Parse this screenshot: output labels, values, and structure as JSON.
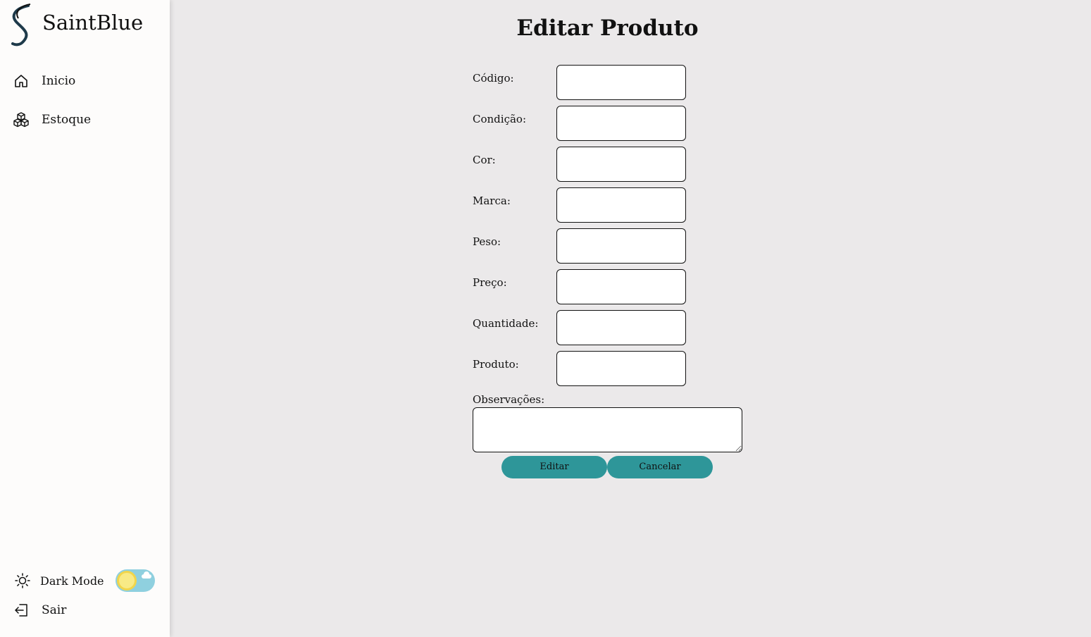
{
  "app": {
    "brand": "SaintBlue"
  },
  "sidebar": {
    "items": [
      {
        "label": "Inicio",
        "icon": "home-icon"
      },
      {
        "label": "Estoque",
        "icon": "boxes-icon"
      }
    ],
    "dark_mode_label": "Dark Mode",
    "dark_mode_enabled": false,
    "logout_label": "Sair"
  },
  "form": {
    "title": "Editar Produto",
    "fields": [
      {
        "label": "Código:",
        "value": ""
      },
      {
        "label": "Condição:",
        "value": ""
      },
      {
        "label": "Cor:",
        "value": ""
      },
      {
        "label": "Marca:",
        "value": ""
      },
      {
        "label": "Peso:",
        "value": ""
      },
      {
        "label": "Preço:",
        "value": ""
      },
      {
        "label": "Quantidade:",
        "value": ""
      },
      {
        "label": "Produto:",
        "value": ""
      }
    ],
    "observations_label": "Observações:",
    "observations_value": "",
    "submit_label": "Editar",
    "cancel_label": "Cancelar"
  },
  "colors": {
    "accent": "#2e9699",
    "background": "#ebe9ea",
    "sidebar": "#fdfcfb"
  }
}
